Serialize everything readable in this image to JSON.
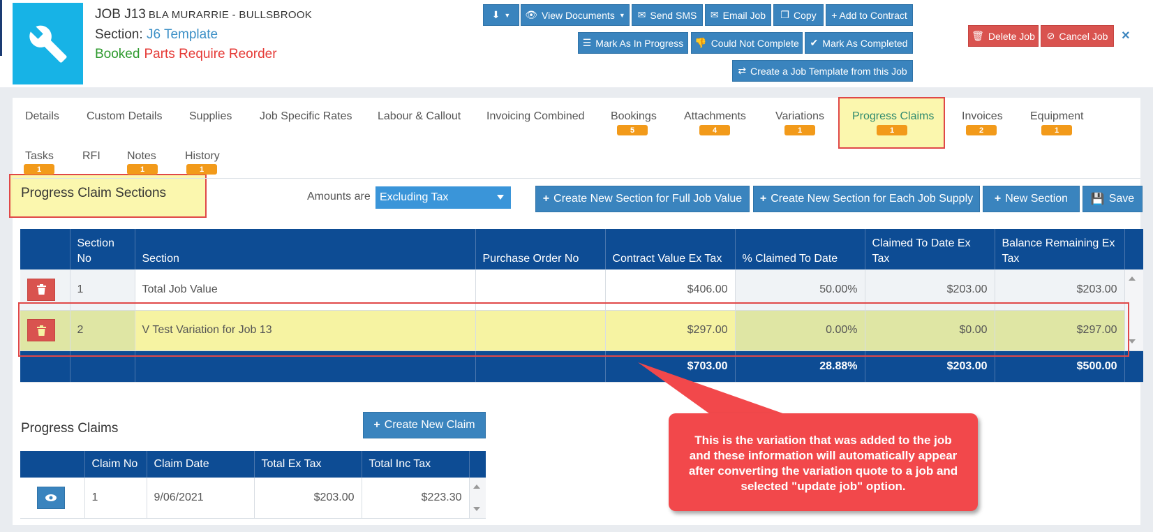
{
  "job": {
    "id": "JOB J13",
    "client": "BLA MURARRIE - BULLSBROOK",
    "section_label": "Section:",
    "section_value": "J6 Template",
    "status_booked": "Booked",
    "status_parts": "Parts Require Reorder"
  },
  "toolbar": {
    "view_documents": "View Documents",
    "send_sms": "Send SMS",
    "email_job": "Email Job",
    "copy": "Copy",
    "add_to_contract": "+ Add to Contract",
    "mark_in_progress": "Mark As In Progress",
    "could_not_complete": "Could Not Complete",
    "mark_completed": "Mark As Completed",
    "create_template": "Create a Job Template from this Job",
    "delete_job": "Delete Job",
    "cancel_job": "Cancel Job",
    "close": "×"
  },
  "tabs": [
    {
      "label": "Details",
      "badge": ""
    },
    {
      "label": "Custom Details",
      "badge": ""
    },
    {
      "label": "Supplies",
      "badge": ""
    },
    {
      "label": "Job Specific Rates",
      "badge": ""
    },
    {
      "label": "Labour & Callout",
      "badge": ""
    },
    {
      "label": "Invoicing Combined",
      "badge": ""
    },
    {
      "label": "Bookings",
      "badge": "5"
    },
    {
      "label": "Attachments",
      "badge": "4"
    },
    {
      "label": "Variations",
      "badge": "1"
    },
    {
      "label": "Progress Claims",
      "badge": "1"
    },
    {
      "label": "Invoices",
      "badge": "2"
    },
    {
      "label": "Equipment",
      "badge": "1"
    },
    {
      "label": "Tasks",
      "badge": "1"
    },
    {
      "label": "RFI",
      "badge": ""
    },
    {
      "label": "Notes",
      "badge": "1"
    },
    {
      "label": "History",
      "badge": "1"
    }
  ],
  "sections": {
    "title": "Progress Claim Sections",
    "amounts_label": "Amounts are",
    "amounts_value": "Excluding Tax",
    "btn_full_job": "Create New Section for Full Job Value",
    "btn_each_supply": "Create New Section for Each Job Supply",
    "btn_new_section": "New Section",
    "btn_save": "Save",
    "headers": [
      "",
      "Section No",
      "Section",
      "Purchase Order No",
      "Contract Value Ex Tax",
      "% Claimed To Date",
      "Claimed To Date Ex Tax",
      "Balance Remaining Ex Tax"
    ],
    "rows": [
      {
        "no": "1",
        "section": "Total Job Value",
        "po": "",
        "contract": "$406.00",
        "pct": "50.00%",
        "claimed": "$203.00",
        "balance": "$203.00"
      },
      {
        "no": "2",
        "section": "V Test Variation for Job 13",
        "po": "",
        "contract": "$297.00",
        "pct": "0.00%",
        "claimed": "$0.00",
        "balance": "$297.00"
      }
    ],
    "totals": {
      "contract": "$703.00",
      "pct": "28.88%",
      "claimed": "$203.00",
      "balance": "$500.00"
    }
  },
  "claims": {
    "title": "Progress Claims",
    "btn_new_claim": "Create New Claim",
    "headers": [
      "",
      "Claim No",
      "Claim Date",
      "Total Ex Tax",
      "Total Inc Tax"
    ],
    "rows": [
      {
        "no": "1",
        "date": "9/06/2021",
        "ex": "$203.00",
        "inc": "$223.30"
      }
    ]
  },
  "callout": {
    "text": "This is the variation that  was added to the job and these information will automatically appear after converting the variation quote to a job and selected \"update job\" option."
  },
  "colors": {
    "primary": "#3a84be",
    "header_blue": "#0d4c94",
    "danger": "#d9534f",
    "badge": "#f29a1a",
    "highlight": "#f6f3a2",
    "callout": "#f2484b"
  }
}
